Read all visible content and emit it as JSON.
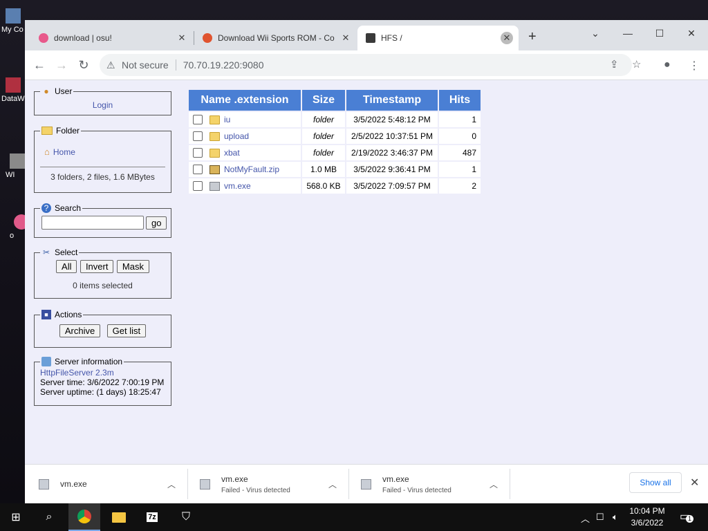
{
  "desktop": {
    "icons": [
      "My Co",
      "DataW",
      "WI",
      "o"
    ]
  },
  "tabs": [
    {
      "title": "download | osu!",
      "close": "✕"
    },
    {
      "title": "Download Wii Sports ROM - Co",
      "close": "✕"
    },
    {
      "title": "HFS /",
      "close": "✕"
    }
  ],
  "new_tab": "+",
  "window_controls": {
    "dropdown": "⌄",
    "minimize": "—",
    "maximize": "☐",
    "close": "✕"
  },
  "address": {
    "security": "Not secure",
    "url": "70.70.19.220:9080"
  },
  "sidebar": {
    "user": {
      "legend": "User",
      "login": "Login"
    },
    "folder": {
      "legend": "Folder",
      "home": "Home",
      "summary": "3 folders, 2 files, 1.6 MBytes"
    },
    "search": {
      "legend": "Search",
      "value": "",
      "go": "go"
    },
    "select": {
      "legend": "Select",
      "all": "All",
      "invert": "Invert",
      "mask": "Mask",
      "status": "0 items selected"
    },
    "actions": {
      "legend": "Actions",
      "archive": "Archive",
      "getlist": "Get list"
    },
    "server": {
      "legend": "Server information",
      "link": "HttpFileServer 2.3m",
      "time": "Server time: 3/6/2022 7:00:19 PM",
      "uptime": "Server uptime: (1 days) 18:25:47"
    }
  },
  "table": {
    "headers": [
      "Name .extension",
      "Size",
      "Timestamp",
      "Hits"
    ],
    "rows": [
      {
        "name": "iu",
        "size": "folder",
        "timestamp": "3/5/2022 5:48:12 PM",
        "hits": "1",
        "kind": "folder"
      },
      {
        "name": "upload",
        "size": "folder",
        "timestamp": "2/5/2022 10:37:51 PM",
        "hits": "0",
        "kind": "folder"
      },
      {
        "name": "xbat",
        "size": "folder",
        "timestamp": "2/19/2022 3:46:37 PM",
        "hits": "487",
        "kind": "folder"
      },
      {
        "name": "NotMyFault.zip",
        "size": "1.0 MB",
        "timestamp": "3/5/2022 9:36:41 PM",
        "hits": "1",
        "kind": "zip"
      },
      {
        "name": "vm.exe",
        "size": "568.0 KB",
        "timestamp": "3/5/2022 7:09:57 PM",
        "hits": "2",
        "kind": "exe"
      }
    ]
  },
  "downloads": {
    "items": [
      {
        "name": "vm.exe",
        "status": ""
      },
      {
        "name": "vm.exe",
        "status": "Failed - Virus detected"
      },
      {
        "name": "vm.exe",
        "status": "Failed - Virus detected"
      }
    ],
    "show_all": "Show all"
  },
  "taskbar": {
    "time": "10:04 PM",
    "date": "3/6/2022",
    "notification_count": "1"
  }
}
